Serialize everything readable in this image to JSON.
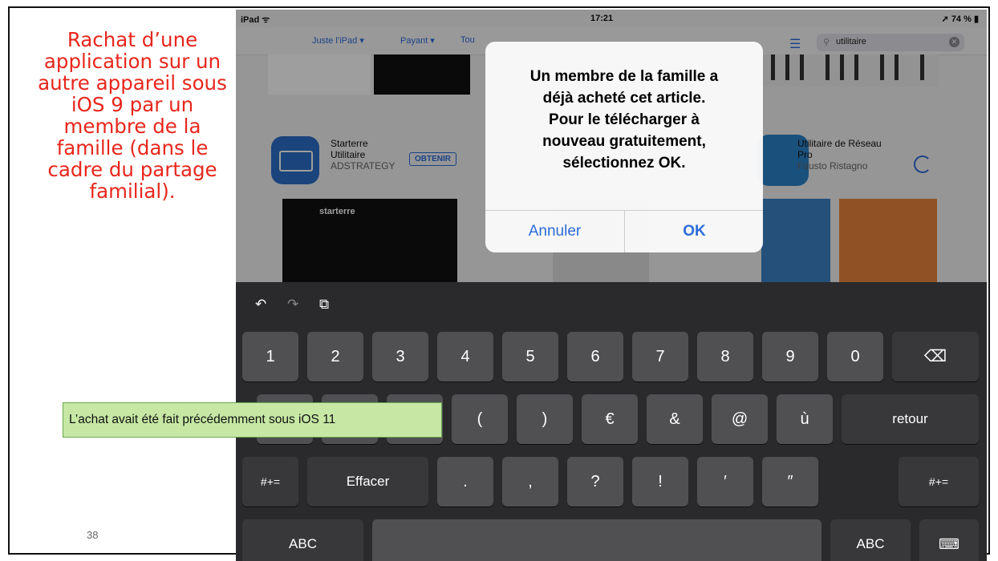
{
  "slide": {
    "title": "Rachat d’une application sur un autre appareil sous iOS 9 par un membre de la famille (dans le cadre du partage familial).",
    "page_number": "38",
    "note": "L’achat avait été fait précédemment sous iOS 11"
  },
  "status": {
    "device": "iPad",
    "time": "17:21",
    "battery": "74 %"
  },
  "nav": {
    "tabs": [
      "Juste l’iPad",
      "Payant",
      "Tou"
    ],
    "search_value": "utilitaire"
  },
  "apps": [
    {
      "name_1": "Starterre",
      "name_2": "Utilitaire",
      "developer": "ADSTRATEGY",
      "action": "OBTENIR"
    },
    {
      "name_1": "Utilitaire de Réseau",
      "name_2": "Pro",
      "developer": "Fausto Ristagno"
    }
  ],
  "screenshot_brand": "starterre",
  "alert": {
    "message_lines": [
      "Un membre de la famille a",
      "déjà acheté cet article.",
      "Pour le télécharger à",
      "nouveau gratuitement,",
      "sélectionnez OK."
    ],
    "cancel": "Annuler",
    "ok": "OK"
  },
  "keyboard": {
    "row1": [
      "1",
      "2",
      "3",
      "4",
      "5",
      "6",
      "7",
      "8",
      "9",
      "0"
    ],
    "row2": [
      "/",
      ":",
      ";",
      "(",
      ")",
      "€",
      "&",
      "@",
      "ù"
    ],
    "return": "retour",
    "row3": [
      ".",
      ",",
      "?",
      "!",
      "′",
      "″"
    ],
    "symbols": "#+=",
    "undo_label": "Effacer",
    "abc": "ABC",
    "icons": [
      "undo-icon",
      "redo-icon",
      "paste-icon",
      "delete-icon",
      "hide-keyboard-icon"
    ]
  }
}
